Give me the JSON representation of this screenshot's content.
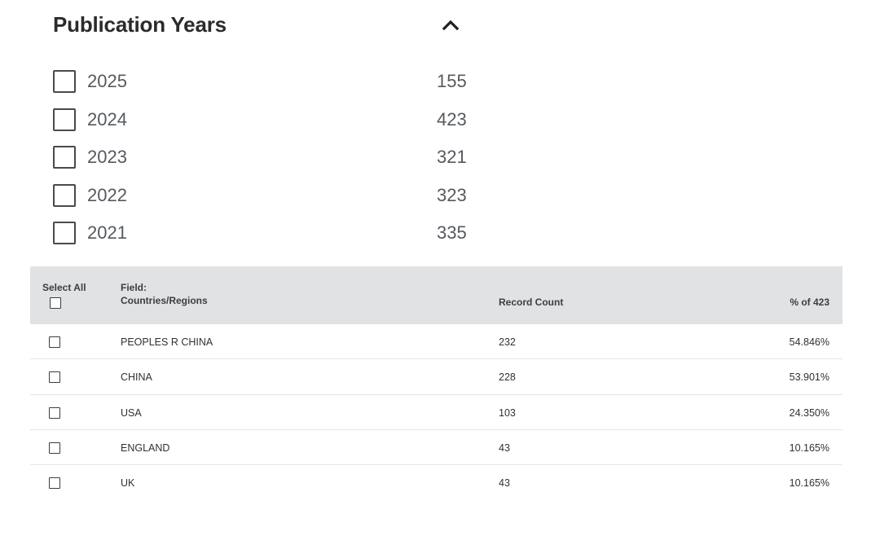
{
  "facet": {
    "title": "Publication Years",
    "toggle_icon": "chevron-up-icon",
    "years": [
      {
        "label": "2025",
        "count": "155"
      },
      {
        "label": "2024",
        "count": "423"
      },
      {
        "label": "2023",
        "count": "321"
      },
      {
        "label": "2022",
        "count": "323"
      },
      {
        "label": "2021",
        "count": "335"
      }
    ]
  },
  "table": {
    "headers": {
      "select_all": "Select All",
      "field_line1": "Field:",
      "field_line2": "Countries/Regions",
      "record_count": "Record Count",
      "percent": "% of 423"
    },
    "rows": [
      {
        "name": "PEOPLES R CHINA",
        "count": "232",
        "percent": "54.846%"
      },
      {
        "name": "CHINA",
        "count": "228",
        "percent": "53.901%"
      },
      {
        "name": "USA",
        "count": "103",
        "percent": "24.350%"
      },
      {
        "name": "ENGLAND",
        "count": "43",
        "percent": "10.165%"
      },
      {
        "name": "UK",
        "count": "43",
        "percent": "10.165%"
      }
    ]
  },
  "colors": {
    "header_bg": "#e1e2e4",
    "text": "#2e3136",
    "muted_text": "#555a60"
  }
}
